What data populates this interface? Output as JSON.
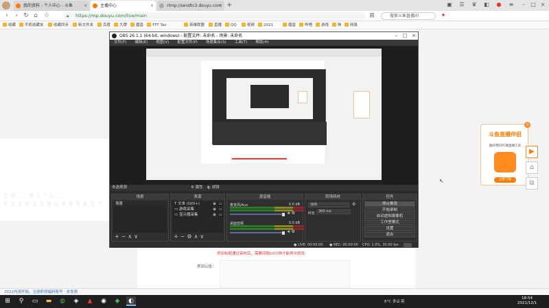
{
  "browser": {
    "tabs": [
      {
        "label": "我的资料 - 个人中心 - 斗鱼",
        "active": false
      },
      {
        "label": "主播中心",
        "active": true
      },
      {
        "label": "rtmp://sendtc3.douyu.com",
        "active": false
      }
    ],
    "new_tab": "+",
    "url": "https://mp.douyu.com/live/main",
    "search_placeholder": "搜索斗鱼直播间",
    "bookmarks": [
      "收藏",
      "手机收藏夹",
      "收藏同步",
      "新文件夹",
      "百度",
      "大牌",
      "魔兽",
      "TFT Tac",
      "英雄联盟",
      "直播",
      "QQ",
      "视频",
      "2021",
      "魔兽",
      "哔哩",
      "游戏",
      "狗",
      "网易"
    ]
  },
  "page": {
    "overlay_text_line1": "Ξ Ψ ... 8 1 ' 1 ...",
    "overlay_text_line2": "5 2 2 4 9 0 8 0 9 8 5 6 2 7",
    "warning": "房间标题通过审核后，需要间隔10分钟才能再次修改",
    "notice_label": "房间公告：",
    "status_link": "2022内测开始，注册即领福利账号 · 去免费",
    "ad": {
      "title": "斗鱼直播伴侣",
      "subtitle": "最好用的PC端直播工具",
      "button": "立即下载",
      "close": "×"
    }
  },
  "obs": {
    "title": "OBS 26.1.1 (64-bit, windows) - 配置文件: 未命名 - 场景: 未命名",
    "menu": [
      "文件(F)",
      "编辑(E)",
      "视图(V)",
      "配置文件(P)",
      "场景集合(S)",
      "工具(T)",
      "帮助(H)"
    ],
    "scene_bar": "未选择源",
    "scene_bar_btns": [
      "属性",
      "滤镜"
    ],
    "docks": {
      "scenes": {
        "title": "场景",
        "items": [
          "场景"
        ]
      },
      "sources": {
        "title": "来源",
        "items": [
          "文本 (GDI+)",
          "游戏采集",
          "显示器采集"
        ]
      },
      "mixer": {
        "title": "混音器",
        "channels": [
          {
            "name": "麦克风/Aux",
            "db": "0.0 dB"
          },
          {
            "name": "桌面音频",
            "db": "0.0 dB"
          }
        ]
      },
      "transitions": {
        "title": "转场特效",
        "type": "淡出",
        "duration_label": "时长",
        "duration": "300 ms"
      },
      "controls": {
        "title": "控件",
        "buttons": [
          "停止推流",
          "开始录制",
          "启动虚拟摄像机",
          "工作室模式",
          "设置",
          "退出"
        ]
      }
    },
    "status": {
      "live": "LIVE: 00:00:00",
      "rec": "REC: 00:00:00",
      "cpu": "CPU: 1.0%, 30.00 fps"
    }
  },
  "taskbar": {
    "time": "18:54",
    "date": "2021/12/1",
    "weather": "8°C 多云",
    "ime": "英"
  },
  "colors": {
    "accent": "#ff7a00",
    "obs_bg": "#2b2b2b",
    "url_green": "#1a7f3a",
    "warning_red": "#ee3333"
  }
}
